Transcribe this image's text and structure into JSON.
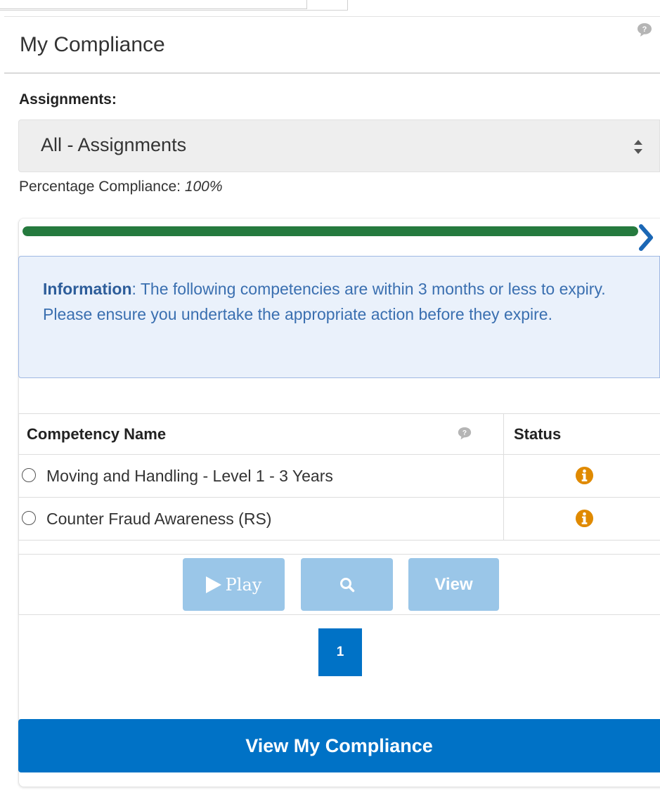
{
  "panel": {
    "title": "My Compliance"
  },
  "assignments": {
    "label": "Assignments:",
    "selected": "All - Assignments"
  },
  "compliance": {
    "label": "Percentage Compliance:",
    "value": "100%",
    "progress_fraction": 1.0,
    "progress_color": "#257a3e"
  },
  "info": {
    "strong": "Information",
    "text": ": The following competencies are within 3 months or less to expiry. Please ensure you undertake the appropriate action before they expire."
  },
  "table": {
    "headers": {
      "name": "Competency Name",
      "status": "Status"
    },
    "rows": [
      {
        "name": "Moving and Handling - Level 1 - 3 Years",
        "status_icon": "info-icon"
      },
      {
        "name": "Counter Fraud Awareness (RS)",
        "status_icon": "info-icon"
      }
    ]
  },
  "actions": {
    "play_label": "Play",
    "view_label": "View",
    "search_icon": "search-icon"
  },
  "pagination": {
    "current_page": "1"
  },
  "footer": {
    "view_compliance_label": "View My Compliance"
  },
  "colors": {
    "primary": "#0072c6",
    "disabled_button": "#9ac6e8",
    "status_icon": "#e08a00",
    "info_text": "#3a6fb0",
    "chevron": "#1b67b5"
  }
}
